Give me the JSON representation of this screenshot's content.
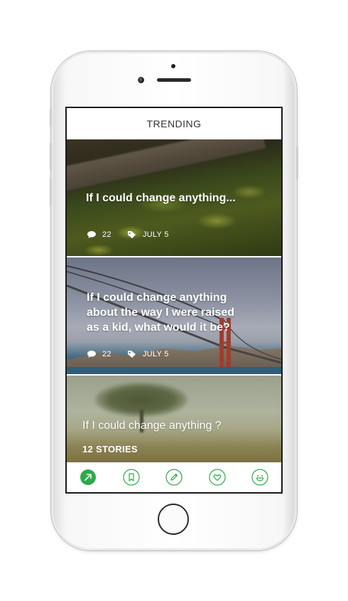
{
  "header": {
    "title": "TRENDING"
  },
  "cards": [
    {
      "title": "If I could change anything...",
      "comments": "22",
      "date": "JULY 5"
    },
    {
      "title_lines": [
        "If I could change anything",
        "about the way I were raised",
        "as a kid, what would it be?"
      ],
      "comments": "22",
      "date": "JULY 5"
    },
    {
      "title": "If I could change anything ?",
      "stories": "12 STORIES"
    }
  ],
  "nav": {
    "items": [
      {
        "icon": "trending-arrow-icon",
        "active": true
      },
      {
        "icon": "bookmark-icon",
        "active": false
      },
      {
        "icon": "pencil-icon",
        "active": false
      },
      {
        "icon": "heart-icon",
        "active": false
      },
      {
        "icon": "smiley-icon",
        "active": false
      }
    ],
    "accent": "#2faa4a"
  }
}
